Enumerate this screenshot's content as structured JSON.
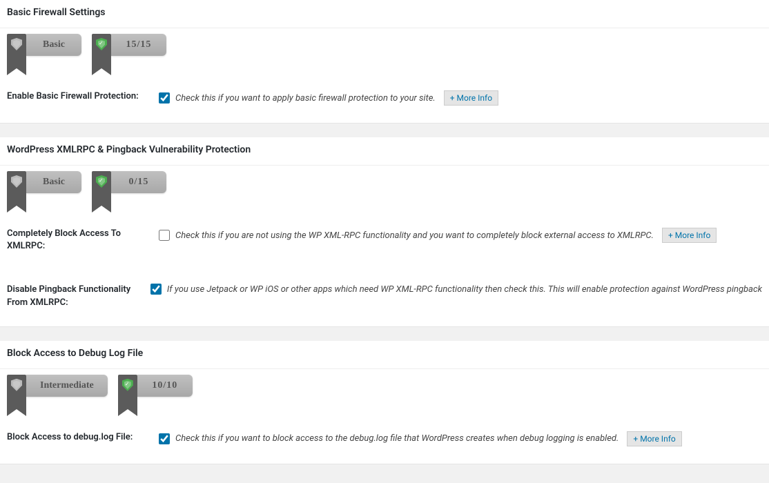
{
  "sections": [
    {
      "key": "basic",
      "heading": "Basic Firewall Settings",
      "level": "Basic",
      "score": "15/15",
      "shield_green": true,
      "rows": [
        {
          "label": "Enable Basic Firewall Protection:",
          "checked": true,
          "desc": "Check this if you want to apply basic firewall protection to your site.",
          "more": "More Info"
        }
      ]
    },
    {
      "key": "xmlrpc",
      "heading": "WordPress XMLRPC & Pingback Vulnerability Protection",
      "level": "Basic",
      "score": "0/15",
      "shield_green": true,
      "rows": [
        {
          "label": "Completely Block Access To XMLRPC:",
          "checked": false,
          "desc": "Check this if you are not using the WP XML-RPC functionality and you want to completely block external access to XMLRPC.",
          "more": "More Info"
        },
        {
          "label": "Disable Pingback Functionality From XMLRPC:",
          "checked": true,
          "desc": "If you use Jetpack or WP iOS or other apps which need WP XML-RPC functionality then check this. This will enable protection against WordPress pingback",
          "more": null
        }
      ]
    },
    {
      "key": "debuglog",
      "heading": "Block Access to Debug Log File",
      "level": "Intermediate",
      "score": "10/10",
      "shield_green": true,
      "rows": [
        {
          "label": "Block Access to debug.log File:",
          "checked": true,
          "desc": "Check this if you want to block access to the debug.log file that WordPress creates when debug logging is enabled.",
          "more": "More Info"
        }
      ]
    }
  ]
}
